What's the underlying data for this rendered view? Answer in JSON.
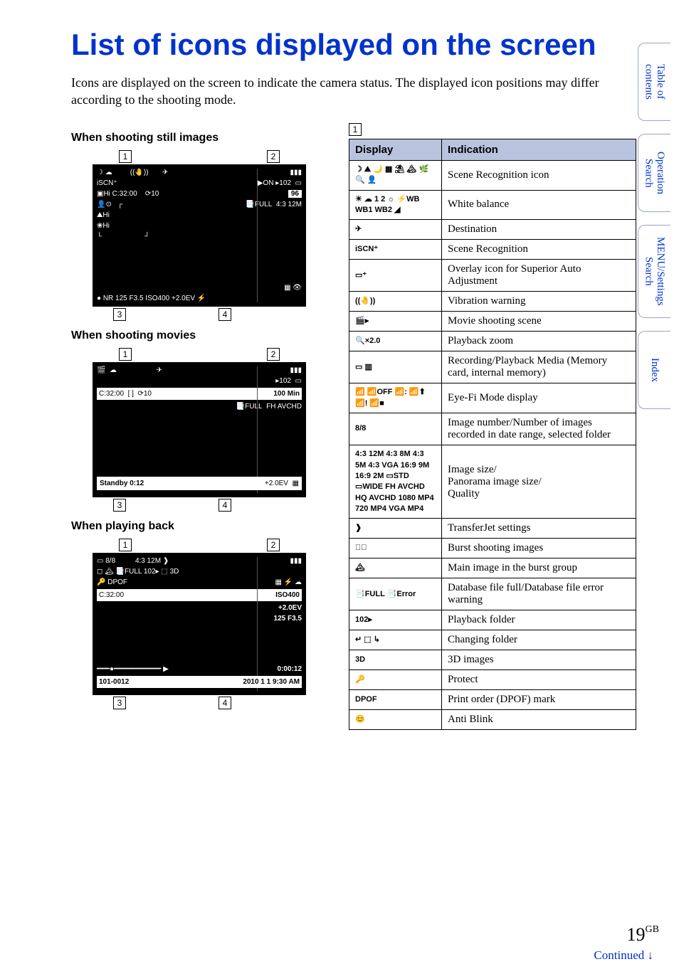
{
  "title": "List of icons displayed on the screen",
  "intro": "Icons are displayed on the screen to indicate the camera status. The displayed icon positions may differ according to the shooting mode.",
  "sections": {
    "still": "When shooting still images",
    "movies": "When shooting movies",
    "playback": "When playing back"
  },
  "callouts": {
    "c1": "1",
    "c2": "2",
    "c3": "3",
    "c4": "4"
  },
  "screens": {
    "still": {
      "top_right_badge": "96",
      "top_right_sub": "4:3 12M",
      "time": "C:32:00",
      "iso_line": "●  NR   125   F3.5   ISO400  +2.0EV  ⚡"
    },
    "movies": {
      "time": "C:32:00",
      "remain": "100 Min",
      "format": "FH AVCHD",
      "status": "Standby   0:12",
      "ev": "+2.0EV"
    },
    "playback": {
      "counter": "8/8",
      "size": "4:3 12M",
      "dpof": "DPOF",
      "time": "C:32:00",
      "iso": "ISO400",
      "ev": "+2.0EV",
      "sf": "125   F3.5",
      "elapsed": "0:00:12",
      "folder": "101-0012",
      "date": "2010  1  1  9:30 AM"
    }
  },
  "table": {
    "header_display": "Display",
    "header_indication": "Indication",
    "rows": [
      {
        "display": "☽ ⛰ 🌙 ▦ ⛱ 🏔 🌿 🔍 👤",
        "indication": "Scene Recognition icon"
      },
      {
        "display": "☀ ☁ 1 2 ☼ ⚡WB WB1 WB2 ◢",
        "indication": "White balance"
      },
      {
        "display": "✈",
        "indication": "Destination"
      },
      {
        "display": "iSCN⁺",
        "indication": "Scene Recognition"
      },
      {
        "display": "▭⁺",
        "indication": "Overlay icon for Superior Auto Adjustment"
      },
      {
        "display": "((🤚))",
        "indication": "Vibration warning"
      },
      {
        "display": "🎬▸",
        "indication": "Movie shooting scene"
      },
      {
        "display": "🔍×2.0",
        "indication": "Playback zoom"
      },
      {
        "display": "▭  ▥",
        "indication": "Recording/Playback Media (Memory card, internal memory)"
      },
      {
        "display": "📶 📶OFF 📶: 📶⬆ 📶! 📶■",
        "indication": "Eye-Fi Mode display"
      },
      {
        "display": "8/8",
        "indication": "Image number/Number of images recorded in date range, selected folder"
      },
      {
        "display": "4:3 12M 4:3 8M 4:3 5M 4:3 VGA 16:9 9M 16:9 2M ▭STD ▭WIDE FH AVCHD HQ AVCHD 1080 MP4 720 MP4 VGA MP4",
        "indication": "Image size/\nPanorama image size/\nQuality"
      },
      {
        "display": "❱",
        "indication": "TransferJet settings"
      },
      {
        "display": "◻⃞",
        "indication": "Burst shooting images"
      },
      {
        "display": "🏔",
        "indication": "Main image in the burst group"
      },
      {
        "display": "📑FULL  📑Error",
        "indication": "Database file full/Database file error warning"
      },
      {
        "display": "102▸",
        "indication": "Playback folder"
      },
      {
        "display": "↵ ⬚ ↳",
        "indication": "Changing folder"
      },
      {
        "display": "3D",
        "indication": "3D images"
      },
      {
        "display": "🔑",
        "indication": "Protect"
      },
      {
        "display": "DPOF",
        "indication": "Print order (DPOF) mark"
      },
      {
        "display": "😊",
        "indication": "Anti Blink"
      }
    ]
  },
  "sidetabs": {
    "toc": "Table of\ncontents",
    "operation": "Operation\nSearch",
    "menu": "MENU/Settings\nSearch",
    "index": "Index"
  },
  "footer": {
    "page_num": "19",
    "page_suffix": "GB",
    "continued": "Continued",
    "arrow": "↓"
  }
}
